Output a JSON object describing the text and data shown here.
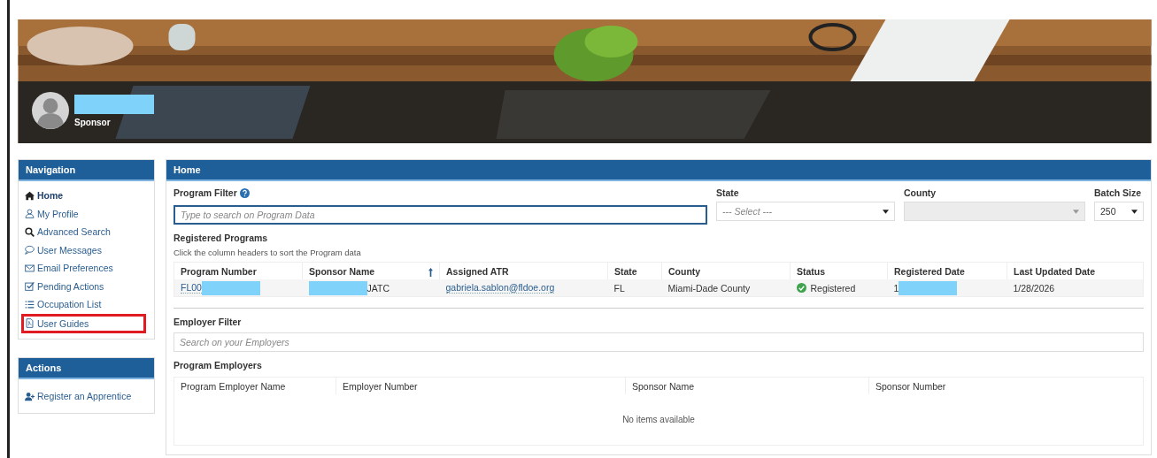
{
  "profile": {
    "role": "Sponsor",
    "name_redacted": true
  },
  "navigation": {
    "title": "Navigation",
    "items": [
      {
        "label": "Home",
        "kind": "home",
        "selected": true,
        "highlighted": false
      },
      {
        "label": "My Profile",
        "kind": "user",
        "selected": false,
        "highlighted": false
      },
      {
        "label": "Advanced Search",
        "kind": "search",
        "selected": false,
        "highlighted": false
      },
      {
        "label": "User Messages",
        "kind": "chat",
        "selected": false,
        "highlighted": false
      },
      {
        "label": "Email Preferences",
        "kind": "mail",
        "selected": false,
        "highlighted": false
      },
      {
        "label": "Pending Actions",
        "kind": "check",
        "selected": false,
        "highlighted": false
      },
      {
        "label": "Occupation List",
        "kind": "list",
        "selected": false,
        "highlighted": false
      },
      {
        "label": "User Guides",
        "kind": "pdf",
        "selected": false,
        "highlighted": true
      }
    ]
  },
  "actions": {
    "title": "Actions",
    "items": [
      {
        "label": "Register an Apprentice",
        "kind": "adduser"
      }
    ]
  },
  "main": {
    "title": "Home",
    "program_filter": {
      "label": "Program Filter",
      "placeholder": "Type to search on Program Data"
    },
    "state_select": {
      "label": "State",
      "value": "--- Select ---",
      "disabled": false
    },
    "county_select": {
      "label": "County",
      "disabled": true
    },
    "batch_select": {
      "label": "Batch Size",
      "value": "250",
      "disabled": false
    },
    "registered_programs": {
      "title": "Registered Programs",
      "hint": "Click the column headers to sort the Program data",
      "columns": [
        {
          "label": "Program Number",
          "sorted": false
        },
        {
          "label": "Sponsor Name",
          "sorted": true
        },
        {
          "label": "Assigned ATR",
          "sorted": false
        },
        {
          "label": "State",
          "sorted": false
        },
        {
          "label": "County",
          "sorted": false
        },
        {
          "label": "Status",
          "sorted": false
        },
        {
          "label": "Registered Date",
          "sorted": false
        },
        {
          "label": "Last Updated Date",
          "sorted": false
        }
      ],
      "rows": [
        [
          {
            "kind": "link",
            "text": "FL00",
            "masked_before": false,
            "masked_after": true
          },
          {
            "kind": "text",
            "text": "JATC",
            "masked_before": true,
            "masked_after": false
          },
          {
            "kind": "link",
            "text": "gabriela.sablon@fldoe.org",
            "masked_before": false,
            "masked_after": false
          },
          {
            "kind": "text",
            "text": "FL",
            "masked_before": false,
            "masked_after": false
          },
          {
            "kind": "text",
            "text": "Miami-Dade County",
            "masked_before": false,
            "masked_after": false
          },
          {
            "kind": "status",
            "text": "Registered",
            "masked_before": false,
            "masked_after": false
          },
          {
            "kind": "text",
            "text": "1",
            "masked_before": false,
            "masked_after": true
          },
          {
            "kind": "text",
            "text": "1/28/2026",
            "masked_before": false,
            "masked_after": false
          }
        ]
      ]
    },
    "employer_filter": {
      "label": "Employer Filter",
      "placeholder": "Search on your Employers"
    },
    "program_employers": {
      "title": "Program Employers",
      "columns": [
        "Program Employer Name",
        "Employer Number",
        "Sponsor Name",
        "Sponsor Number"
      ],
      "empty_text": "No items available"
    }
  }
}
